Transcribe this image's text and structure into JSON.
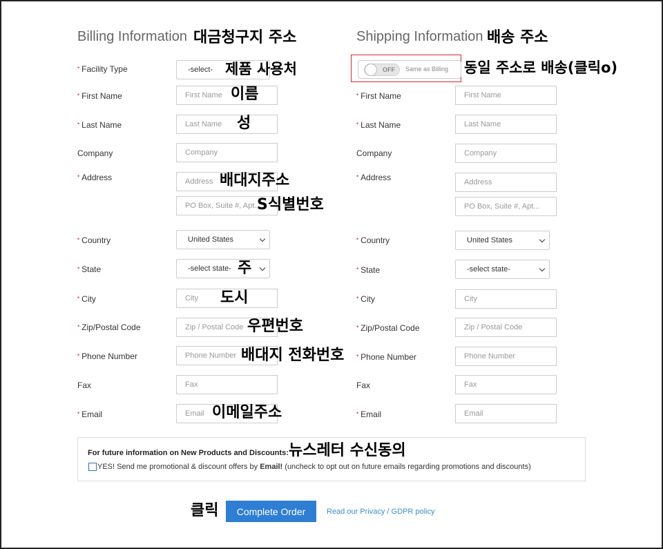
{
  "billing": {
    "title": "Billing Information",
    "annotation": "대금청구지 주소",
    "fields": {
      "facility_type": {
        "label": "Facility Type",
        "value": "-select-",
        "annotation": "제품 사용처"
      },
      "first_name": {
        "label": "First Name",
        "placeholder": "First Name",
        "annotation": "이름"
      },
      "last_name": {
        "label": "Last Name",
        "placeholder": "Last Name",
        "annotation": "성"
      },
      "company": {
        "label": "Company",
        "placeholder": "Company"
      },
      "address": {
        "label": "Address",
        "placeholder": "Address",
        "annotation": "배대지주소"
      },
      "address2": {
        "placeholder": "PO Box, Suite #, Apt...",
        "annotation": "S식별번호"
      },
      "country": {
        "label": "Country",
        "value": "United States"
      },
      "state": {
        "label": "State",
        "value": "-select state-",
        "annotation": "주"
      },
      "city": {
        "label": "City",
        "placeholder": "City",
        "annotation": "도시"
      },
      "zip": {
        "label": "Zip/Postal Code",
        "placeholder": "Zip / Postal Code",
        "annotation": "우편번호"
      },
      "phone": {
        "label": "Phone Number",
        "placeholder": "Phone Number",
        "annotation": "배대지 전화번호"
      },
      "fax": {
        "label": "Fax",
        "placeholder": "Fax"
      },
      "email": {
        "label": "Email",
        "placeholder": "Email",
        "annotation": "이메일주소"
      }
    }
  },
  "shipping": {
    "title": "Shipping Information",
    "annotation": "배송 주소",
    "toggle": {
      "state": "OFF",
      "label": "Same as Billing",
      "annotation": "동일 주소로 배송(클릭o)"
    },
    "fields": {
      "first_name": {
        "label": "First Name",
        "placeholder": "First Name"
      },
      "last_name": {
        "label": "Last Name",
        "placeholder": "Last Name"
      },
      "company": {
        "label": "Company",
        "placeholder": "Company"
      },
      "address": {
        "label": "Address",
        "placeholder": "Address"
      },
      "address2": {
        "placeholder": "PO Box, Suite #, Apt..."
      },
      "country": {
        "label": "Country",
        "value": "United States"
      },
      "state": {
        "label": "State",
        "value": "-select state-"
      },
      "city": {
        "label": "City",
        "placeholder": "City"
      },
      "zip": {
        "label": "Zip/Postal Code",
        "placeholder": "Zip / Postal Code"
      },
      "phone": {
        "label": "Phone Number",
        "placeholder": "Phone Number"
      },
      "fax": {
        "label": "Fax",
        "placeholder": "Fax"
      },
      "email": {
        "label": "Email",
        "placeholder": "Email"
      }
    }
  },
  "newsletter": {
    "title": "For future information on New Products and Discounts:",
    "annotation": "뉴스레터 수신동의",
    "checkbox_prefix": "YES! Send me promotional & discount offers by ",
    "checkbox_bold": "Email!",
    "checkbox_suffix": " (uncheck to opt out on future emails regarding promotions and discounts)"
  },
  "footer": {
    "button_annotation": "클릭",
    "complete_order": "Complete Order",
    "privacy_link": "Read our Privacy / GDPR policy"
  },
  "colors": {
    "accent_button": "#2e7ed3",
    "required_mark": "#d9534f",
    "highlight_box": "#d9262c",
    "link": "#3a8fcf"
  }
}
